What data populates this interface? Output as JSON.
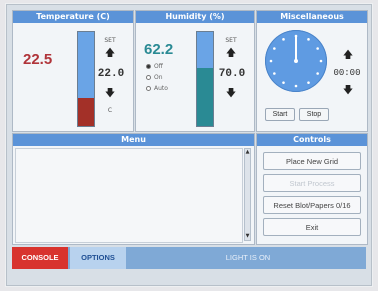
{
  "temperature": {
    "header": "Temperature (C)",
    "current": "22.5",
    "setpoint_label": "SET",
    "setpoint": "22.0",
    "level_fraction": 0.3,
    "unit_label": "C",
    "bar_color": "#6aa4e6",
    "fill_color": "#a33028",
    "reading_color": "#b0343a"
  },
  "humidity": {
    "header": "Humidity (%)",
    "current": "62.2",
    "setpoint_label": "SET",
    "setpoint": "70.0",
    "level_fraction": 0.62,
    "modes": [
      "Off",
      "On",
      "Auto"
    ],
    "selected_mode": "Off",
    "bar_color": "#6aa4e6",
    "fill_color": "#2a8a94",
    "reading_color": "#2a8a94"
  },
  "misc": {
    "header": "Miscellaneous",
    "timer": "00:00",
    "start_label": "Start",
    "stop_label": "Stop"
  },
  "menu": {
    "header": "Menu"
  },
  "controls": {
    "header": "Controls",
    "buttons": [
      {
        "label": "Place New Grid",
        "enabled": true
      },
      {
        "label": "Start Process",
        "enabled": false
      },
      {
        "label": "Reset Blot/Papers 0/16",
        "enabled": true
      },
      {
        "label": "Exit",
        "enabled": true
      }
    ]
  },
  "bottom": {
    "console_label": "CONSOLE",
    "options_label": "OPTIONS",
    "status_text": "LIGHT IS ON"
  },
  "colors": {
    "header_blue": "#5b93d8",
    "console_red": "#d8332e",
    "options_text": "#1f4f94",
    "status_bar": "#7fa9d6"
  },
  "icons": {
    "up": "arrow-up-icon",
    "down": "arrow-down-icon",
    "clock": "clock-icon"
  }
}
